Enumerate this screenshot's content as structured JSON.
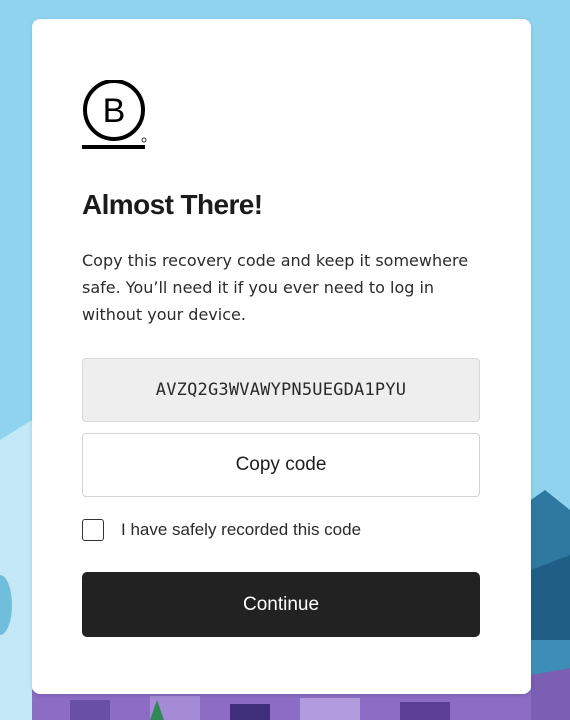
{
  "colors": {
    "page_background": "#8fd3ef",
    "card_background": "#ffffff",
    "primary_button": "#222222",
    "code_box_background": "#edeeed"
  },
  "logo": {
    "icon": "b-corp-logo-icon"
  },
  "title": "Almost There!",
  "description": "Copy this recovery code and keep it somewhere safe. You’ll need it if you ever need to log in without your device.",
  "recovery_code": "AVZQ2G3WVAWYPN5UEGDA1PYU",
  "copy_button_label": "Copy code",
  "checkbox": {
    "label": "I have safely recorded this code",
    "checked": false
  },
  "continue_button_label": "Continue"
}
